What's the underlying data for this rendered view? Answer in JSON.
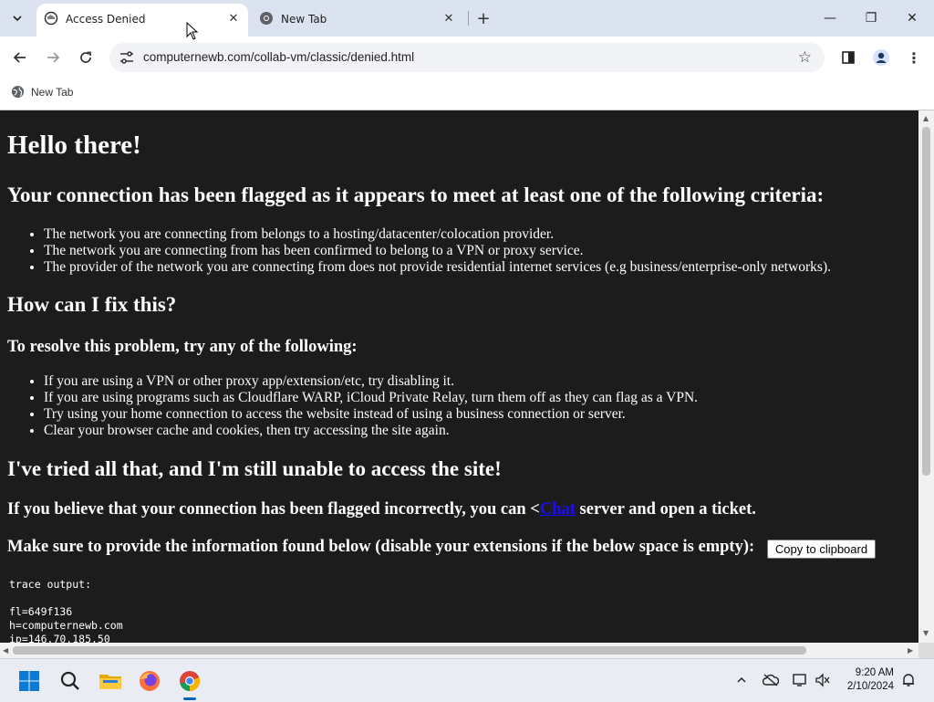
{
  "browser": {
    "tabs": [
      {
        "title": "Access Denied",
        "active": true,
        "icon": "hand-icon"
      },
      {
        "title": "New Tab",
        "active": false,
        "icon": "chrome-icon"
      }
    ],
    "url": "computernewb.com/collab-vm/classic/denied.html",
    "bookmarks": [
      {
        "label": "New Tab",
        "icon": "globe-icon"
      }
    ],
    "window_controls": {
      "minimize": "—",
      "restore": "❐",
      "close": "✕"
    }
  },
  "page": {
    "h1": "Hello there!",
    "criteria_heading": "Your connection has been flagged as it appears to meet at least one of the following criteria:",
    "criteria": [
      "The network you are connecting from belongs to a hosting/datacenter/colocation provider.",
      "The network you are connecting from has been confirmed to belong to a VPN or proxy service.",
      "The provider of the network you are connecting from does not provide residential internet services (e.g business/enterprise-only networks)."
    ],
    "fix_heading": "How can I fix this?",
    "fix_subheading": "To resolve this problem, try any of the following:",
    "fixes": [
      "If you are using a VPN or other proxy app/extension/etc, try disabling it.",
      "If you are using programs such as Cloudflare WARP, iCloud Private Relay, turn them off as they can flag as a VPN.",
      "Try using your home connection to access the website instead of using a business connection or server.",
      "Clear your browser cache and cookies, then try accessing the site again."
    ],
    "tried_heading": "I've tried all that, and I'm still unable to access the site!",
    "ticket_pre": "If you believe that your connection has been flagged incorrectly, you can <",
    "ticket_link": "Chat",
    "ticket_post": " server and open a ticket.",
    "info_text": "Make sure to provide the information found below (disable your extensions if the below space is empty):",
    "copy_button": "Copy to clipboard",
    "trace": "trace output:\n\nfl=649f136\nh=computernewb.com\nip=146.70.185.50"
  },
  "taskbar": {
    "time": "9:20 AM",
    "date": "2/10/2024"
  }
}
